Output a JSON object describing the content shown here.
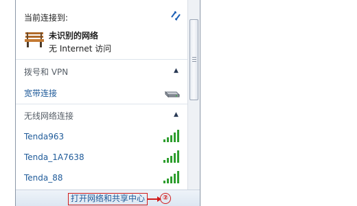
{
  "current": {
    "label": "当前连接到:",
    "network_name": "未识别的网络",
    "network_status": "无 Internet 访问"
  },
  "dialup": {
    "header": "拨号和 VPN",
    "items": [
      {
        "label": "宽带连接"
      }
    ]
  },
  "wireless": {
    "header": "无线网络连接",
    "networks": [
      {
        "name": "Tenda963"
      },
      {
        "name": "Tenda_1A7638"
      },
      {
        "name": "Tenda_88"
      }
    ]
  },
  "footer": {
    "link_label": "打开网络和共享中心",
    "annotation": "②"
  },
  "colors": {
    "link": "#1e5a99",
    "annotation": "#d11a1a",
    "signal": "#2e9e2e"
  }
}
